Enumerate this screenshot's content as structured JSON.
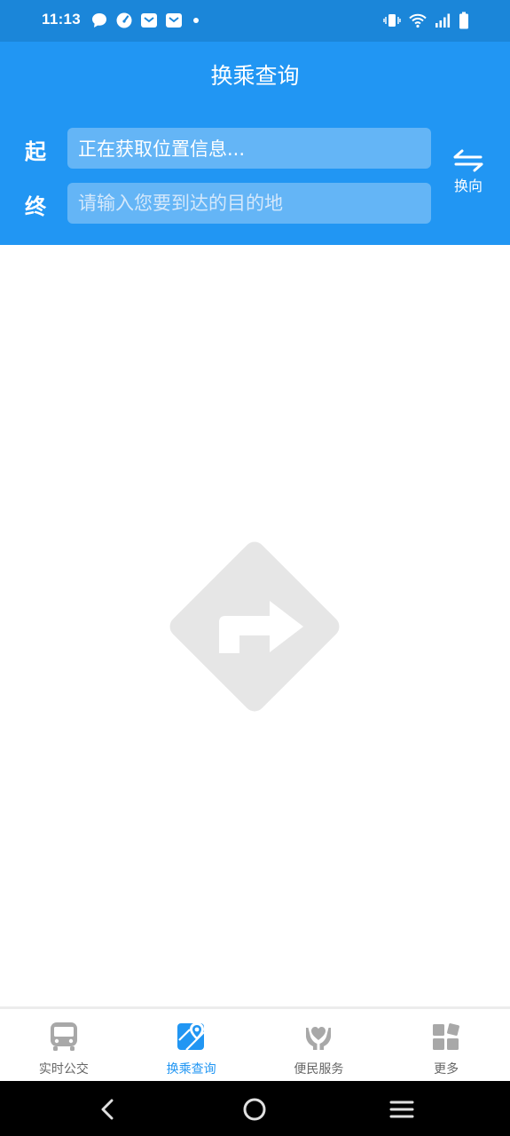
{
  "status_bar": {
    "time": "11:13",
    "notification_icons": [
      "chat-bubble-icon",
      "speedometer-icon",
      "mail-icon",
      "mail-icon",
      "more-dot-icon"
    ],
    "system_icons": [
      "vibrate-icon",
      "wifi-icon",
      "signal-icon",
      "battery-icon"
    ]
  },
  "header": {
    "title": "换乘查询",
    "start_label": "起",
    "start_value": "正在获取位置信息...",
    "end_label": "终",
    "end_placeholder": "请输入您要到达的目的地",
    "swap_label": "换向"
  },
  "content": {
    "empty_state_icon": "turn-right-sign-icon"
  },
  "tabs": [
    {
      "label": "实时公交",
      "icon": "bus-icon",
      "active": false
    },
    {
      "label": "换乘查询",
      "icon": "map-pin-icon",
      "active": true
    },
    {
      "label": "便民服务",
      "icon": "heart-hand-icon",
      "active": false
    },
    {
      "label": "更多",
      "icon": "grid-icon",
      "active": false
    }
  ],
  "nav_bar": [
    "back-icon",
    "home-icon",
    "menu-icon"
  ],
  "colors": {
    "status_bar": "#1b86d9",
    "header": "#2196f3",
    "input_bg": "#64b5f6",
    "tab_active": "#2196f3",
    "tab_inactive": "#9e9e9e",
    "empty_icon": "#e6e6e6"
  }
}
